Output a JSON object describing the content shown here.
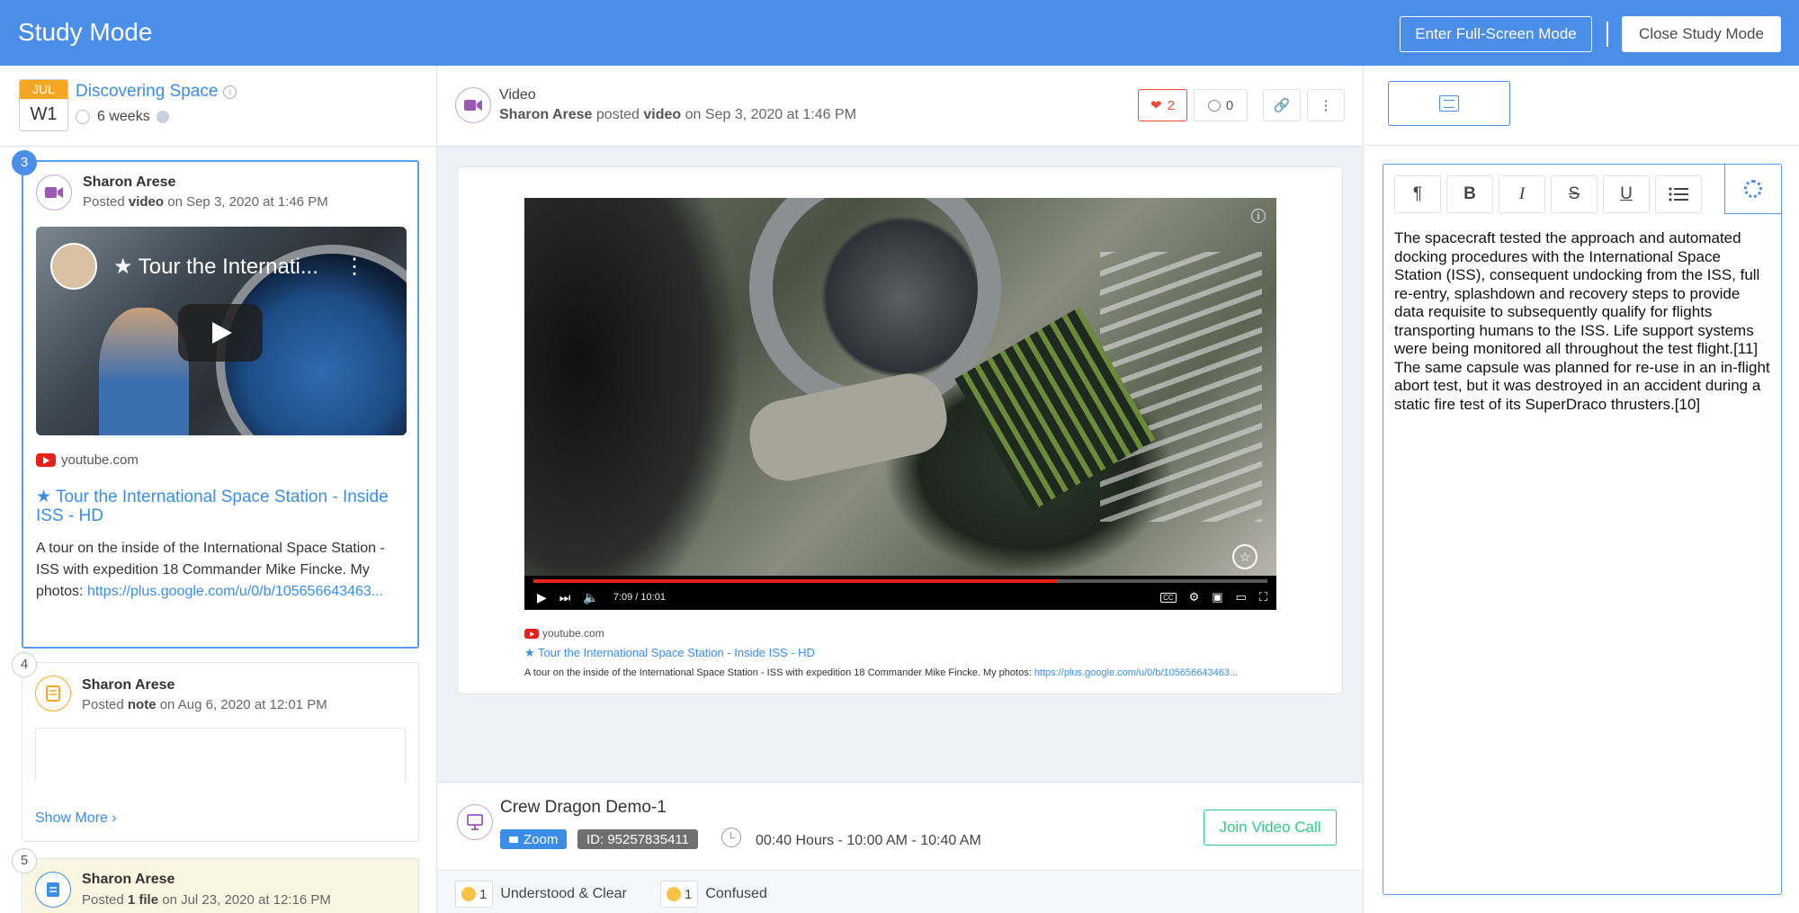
{
  "app": {
    "title": "Study Mode",
    "fullscreen_label": "Enter Full-Screen Mode",
    "close_label": "Close Study Mode"
  },
  "course": {
    "month": "JUL",
    "week": "W1",
    "name": "Discovering Space",
    "duration": "6 weeks"
  },
  "posts": [
    {
      "num": "3",
      "author": "Sharon Arese",
      "posted_prefix": "Posted",
      "type": "video",
      "date": "on Sep 3, 2020 at 1:46 PM",
      "thumb_title": "★ Tour the Internati...",
      "source": "youtube.com",
      "link_title": "★ Tour the International Space Station - Inside ISS - HD",
      "description": "A tour on the inside of the International Space Station - ISS with expedition 18 Commander Mike Fincke. My photos:",
      "url": "https://plus.google.com/u/0/b/105656643463..."
    },
    {
      "num": "4",
      "author": "Sharon Arese",
      "posted_prefix": "Posted",
      "type": "note",
      "date": "on Aug 6, 2020 at 12:01 PM",
      "show_more": "Show More ›"
    },
    {
      "num": "5",
      "author": "Sharon Arese",
      "posted_prefix": "Posted",
      "type": "1 file",
      "date": "on Jul 23, 2020 at 12:16 PM"
    }
  ],
  "main": {
    "type_label": "Video",
    "author": "Sharon Arese",
    "verb": "posted",
    "object": "video",
    "date": "on Sep 3, 2020 at 1:46 PM",
    "likes": "2",
    "comments": "0",
    "player": {
      "time": "7:09 / 10:01",
      "progress": 0.714
    },
    "source": "youtube.com",
    "link_title": "★ Tour the International Space Station - Inside ISS - HD",
    "description": "A tour on the inside of the International Space Station - ISS with expedition 18 Commander Mike Fincke. My photos:",
    "url": "https://plus.google.com/u/0/b/105656643463..."
  },
  "event": {
    "title": "Crew Dragon Demo-1",
    "platform": "Zoom",
    "meeting_id": "ID: 95257835411",
    "hours": "00:40 Hours - 10:00 AM - 10:40 AM",
    "join_label": "Join Video Call",
    "reactions": [
      {
        "count": "1",
        "label": "Understood & Clear"
      },
      {
        "count": "1",
        "label": "Confused"
      }
    ]
  },
  "editor": {
    "toolbar": [
      "¶",
      "B",
      "I",
      "S",
      "U"
    ],
    "text": "The spacecraft tested the approach and automated docking procedures with the International Space Station (ISS), consequent undocking from the ISS, full re-entry, splashdown and recovery steps to provide data requisite to subsequently qualify for flights transporting humans to the ISS. Life support systems were being monitored all throughout the test flight.[11] The same capsule was planned for re-use in an in-flight abort test, but it was destroyed in an accident during a static fire test of its SuperDraco thrusters.[10]"
  },
  "colors": {
    "brand": "#4a8eea",
    "like": "#e74c3c",
    "join": "#2ecc8a",
    "youtube": "#e62117"
  }
}
